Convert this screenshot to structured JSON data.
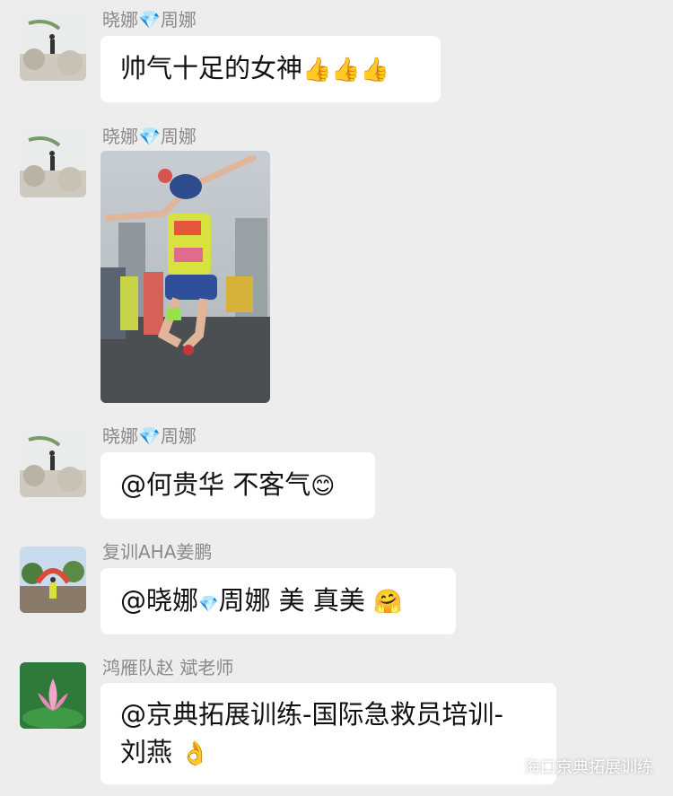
{
  "messages": [
    {
      "sender": "晓娜💎周娜",
      "text": "帅气十足的女神",
      "emoji": "👍👍👍"
    },
    {
      "sender": "晓娜💎周娜",
      "image": "photo of jumping runner"
    },
    {
      "sender": "晓娜💎周娜",
      "text": "@何贵华 不客气",
      "emoji": "😊"
    },
    {
      "sender": "复训AHA姜鹏",
      "text_prefix": "@晓娜",
      "text_gem": "💎",
      "text_suffix": "周娜 美 真美",
      "emoji": "🤗"
    },
    {
      "sender": "鸿雁队赵 斌老师",
      "text_line1": "@京典拓展训练-国际急救员培训-",
      "text_line2": "刘燕",
      "emoji": "👌"
    }
  ],
  "watermark": {
    "text": "海口京典拓展训练",
    "icon": "wechat-icon"
  },
  "colors": {
    "background": "#ededed",
    "bubble": "#ffffff",
    "name": "#8a8a8a"
  }
}
